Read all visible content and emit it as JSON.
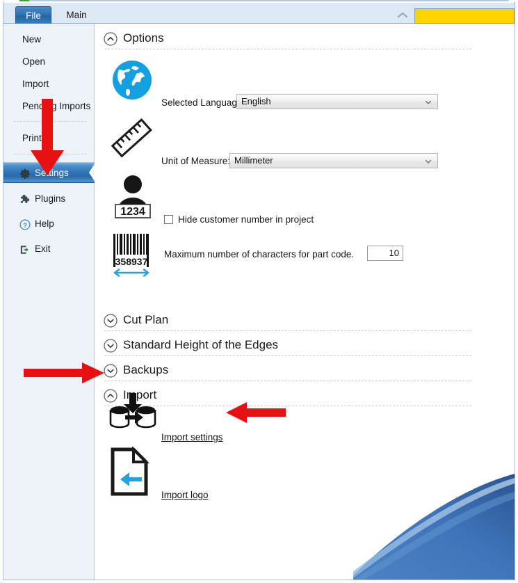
{
  "window": {
    "accent_blue": "#2f74b6",
    "sidebar_bg": "#eef3fa",
    "redaction_color": "#ffd400"
  },
  "tabs": {
    "file_label": "File",
    "main_label": "Main",
    "ribbon_collapse_icon": "chevron-up-icon",
    "redacted_field_label": ""
  },
  "sidebar": {
    "items": [
      {
        "label": "New",
        "icon": ""
      },
      {
        "label": "Open",
        "icon": ""
      },
      {
        "label": "Import",
        "icon": ""
      },
      {
        "label": "Pending Imports",
        "icon": ""
      },
      {
        "label": "Print",
        "icon": ""
      },
      {
        "label": "Settings",
        "icon": "gear-icon"
      },
      {
        "label": "Plugins",
        "icon": "puzzle-piece-icon"
      },
      {
        "label": "Help",
        "icon": "question-circle-icon"
      },
      {
        "label": "Exit",
        "icon": "exit-arrow-icon"
      }
    ],
    "selected": "Settings"
  },
  "sections": {
    "options": {
      "title": "Options",
      "expanded": true,
      "chevron": "chevron-up-icon"
    },
    "cut_plan": {
      "title": "Cut Plan",
      "expanded": false,
      "chevron": "chevron-down-icon"
    },
    "standard_height": {
      "title": "Standard Height of the Edges",
      "expanded": false,
      "chevron": "chevron-down-icon"
    },
    "backups": {
      "title": "Backups",
      "expanded": false,
      "chevron": "chevron-down-icon"
    },
    "import": {
      "title": "Import",
      "expanded": true,
      "chevron": "chevron-up-icon"
    }
  },
  "options": {
    "language": {
      "icon": "globe-icon",
      "label": "Selected Language:",
      "value": "English"
    },
    "unit": {
      "icon": "ruler-icon",
      "label": "Unit of Measure:",
      "value": "Millimeter"
    },
    "hide_customer": {
      "icon": "customer-number-icon",
      "icon_text": "1234",
      "label": "Hide customer number in project",
      "checked": false
    },
    "part_code": {
      "icon": "barcode-icon",
      "icon_text": "358937",
      "label": "Maximum number of characters for part code.",
      "value": "10"
    }
  },
  "import_section": {
    "settings_link": {
      "icon": "database-import-icon",
      "label": "Import settings"
    },
    "logo_link": {
      "icon": "document-import-icon",
      "label": "Import logo"
    }
  },
  "annotations": {
    "arrow_to_settings": "red-down-arrow",
    "arrow_to_import_section": "red-right-arrow",
    "arrow_to_import_settings": "red-left-arrow"
  }
}
